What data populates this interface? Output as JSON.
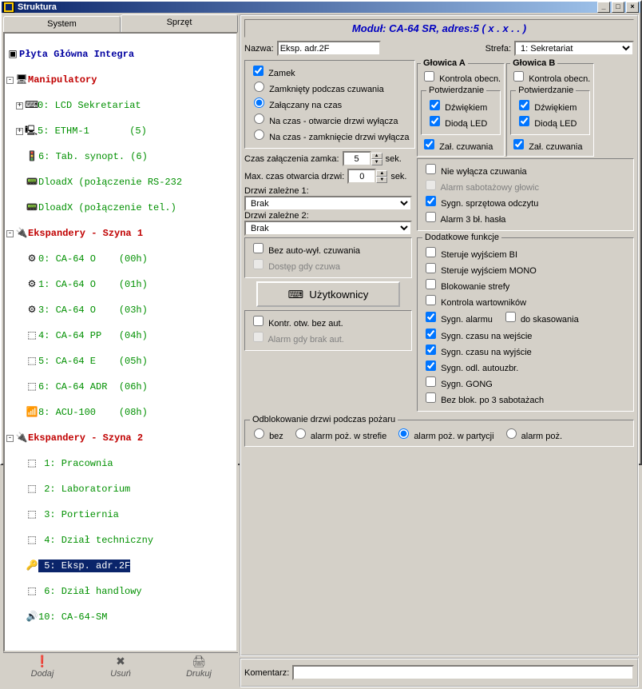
{
  "window": {
    "title": "Struktura"
  },
  "tabs": {
    "system": "System",
    "sprzet": "Sprzęt"
  },
  "tree": {
    "root": "Płyta Główna Integra",
    "g1": "Manipulatory",
    "g1i": [
      "0: LCD Sekretariat",
      "5: ETHM-1       (5)",
      "6: Tab. synopt. (6)",
      "DloadX (połączenie RS-232",
      "DloadX (połączenie tel.)"
    ],
    "g2": "Ekspandery - Szyna 1",
    "g2i": [
      "0: CA-64 O    (00h)",
      "1: CA-64 O    (01h)",
      "3: CA-64 O    (03h)",
      "4: CA-64 PP   (04h)",
      "5: CA-64 E    (05h)",
      "6: CA-64 ADR  (06h)",
      "8: ACU-100    (08h)"
    ],
    "g3": "Ekspandery - Szyna 2",
    "g3i": [
      " 1: Pracownia",
      " 2: Laboratorium",
      " 3: Portiernia",
      " 4: Dział techniczny",
      " 5: Eksp. adr.2F",
      " 6: Dział handlowy",
      "10: CA-64-SM"
    ]
  },
  "bottom": {
    "add": "Dodaj",
    "del": "Usuń",
    "print": "Drukuj"
  },
  "header": "Moduł: CA-64 SR, adres:5 ( x . x . . )",
  "nazwa_l": "Nazwa:",
  "nazwa_v": "Eksp. adr.2F",
  "strefa_l": "Strefa:",
  "strefa_v": "1: Sekretariat",
  "zamek": {
    "title": "Zamek",
    "r1": "Zamknięty podczas czuwania",
    "r2": "Załączany na czas",
    "r3": "Na czas - otwarcie drzwi wyłącza",
    "r4": "Na czas - zamknięcie drzwi wyłącza"
  },
  "czas_zal_l": "Czas załączenia zamka:",
  "czas_zal_v": "5",
  "sek": "sek.",
  "max_otw_l": "Max. czas otwarcia drzwi:",
  "max_otw_v": "0",
  "dz1_l": "Drzwi zależne 1:",
  "dz1_v": "Brak",
  "dz2_l": "Drzwi zależne 2:",
  "dz2_v": "Brak",
  "bez_auto": "Bez auto-wył. czuwania",
  "dostep": "Dostęp gdy czuwa",
  "uzytk": "Użytkownicy",
  "kontr": "Kontr. otw. bez aut.",
  "alarmgdy": "Alarm gdy brak aut.",
  "odblok": {
    "legend": "Odblokowanie drzwi podczas pożaru",
    "o1": "bez",
    "o2": "alarm poż. w strefie",
    "o3": "alarm poż. w partycji",
    "o4": "alarm poż."
  },
  "koment_l": "Komentarz:",
  "koment_v": "",
  "glA": "Głowica A",
  "glB": "Głowica B",
  "kontrola": "Kontrola obecn.",
  "potw": "Potwierdzanie",
  "dzwiek": "Dźwiękiem",
  "dioda": "Diodą LED",
  "zalcz": "Zał. czuwania",
  "niewyl": "Nie wyłącza czuwania",
  "alsab": "Alarm sabotażowy głowic",
  "sygspr": "Sygn. sprzętowa odczytu",
  "al3bl": "Alarm 3 bł. hasła",
  "dodfun": "Dodatkowe funkcje",
  "sterbi": "Steruje wyjściem BI",
  "stermono": "Steruje wyjściem MONO",
  "blokstr": "Blokowanie strefy",
  "kontwart": "Kontrola wartowników",
  "sygal": "Sygn. alarmu",
  "dokas": "do skasowania",
  "sygwe": "Sygn. czasu na wejście",
  "sygwy": "Sygn. czasu na wyjście",
  "sygodl": "Sygn. odl. autouzbr.",
  "syggong": "Sygn. GONG",
  "bezblok": "Bez blok. po 3 sabotażach"
}
